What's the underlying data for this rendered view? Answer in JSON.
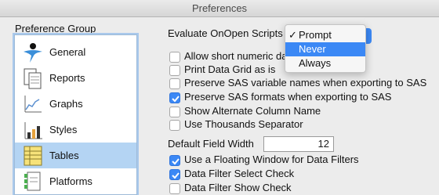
{
  "window": {
    "title": "Preferences"
  },
  "sidebar": {
    "label": "Preference Group",
    "items": [
      {
        "label": "General",
        "icon": "general-icon",
        "selected": false
      },
      {
        "label": "Reports",
        "icon": "reports-icon",
        "selected": false
      },
      {
        "label": "Graphs",
        "icon": "graphs-icon",
        "selected": false
      },
      {
        "label": "Styles",
        "icon": "styles-icon",
        "selected": false
      },
      {
        "label": "Tables",
        "icon": "tables-icon",
        "selected": true
      },
      {
        "label": "Platforms",
        "icon": "platforms-icon",
        "selected": false
      }
    ]
  },
  "settings": {
    "evaluate_label": "Evaluate OnOpen Scripts",
    "evaluate_menu": {
      "options": [
        "Prompt",
        "Never",
        "Always"
      ],
      "checked": "Prompt",
      "highlighted": "Never"
    },
    "checkboxes": [
      {
        "label": "Allow short numeric da",
        "checked": false
      },
      {
        "label": "Print Data Grid as is",
        "checked": false
      },
      {
        "label": "Preserve SAS variable names when exporting to SAS",
        "checked": false
      },
      {
        "label": "Preserve SAS formats when exporting to SAS",
        "checked": true
      },
      {
        "label": "Show Alternate Column Name",
        "checked": false
      },
      {
        "label": "Use Thousands Separator",
        "checked": false
      }
    ],
    "field_width_label": "Default Field Width",
    "field_width_value": "12",
    "checkboxes_bottom": [
      {
        "label": "Use a Floating Window for Data Filters",
        "checked": true
      },
      {
        "label": "Data Filter Select Check",
        "checked": true
      },
      {
        "label": "Data Filter Show Check",
        "checked": false
      }
    ]
  },
  "colors": {
    "accent": "#3b88f5",
    "selection": "#b4d4f3"
  }
}
